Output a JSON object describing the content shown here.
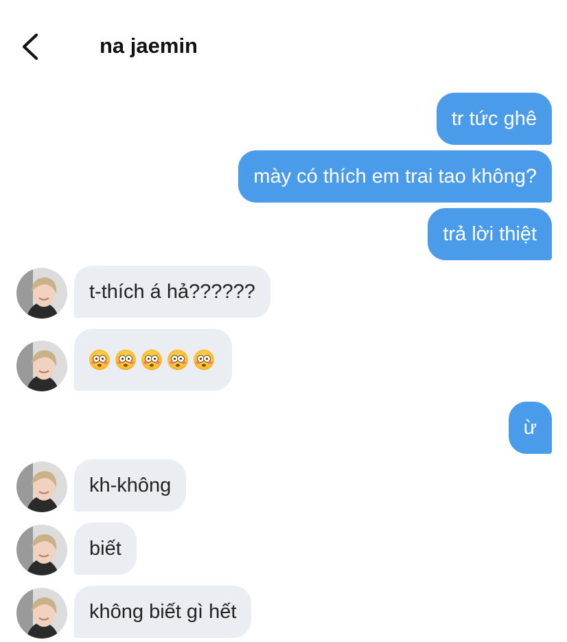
{
  "header": {
    "contact_name": "na jaemin",
    "back_icon": "chevron-left-icon"
  },
  "colors": {
    "outgoing_bubble": "#4a9bea",
    "incoming_bubble": "#eaedf1"
  },
  "messages": [
    {
      "direction": "outgoing",
      "text": "tr tức ghê"
    },
    {
      "direction": "outgoing",
      "text": "mày có thích em trai tao không?"
    },
    {
      "direction": "outgoing",
      "text": "trả lời thiệt"
    },
    {
      "direction": "incoming",
      "text": "t-thích á hả??????"
    },
    {
      "direction": "incoming",
      "text": "",
      "emoji": [
        "flushed-face",
        "flushed-face",
        "flushed-face",
        "flushed-face",
        "flushed-face"
      ]
    },
    {
      "direction": "outgoing",
      "text": "ừ"
    },
    {
      "direction": "incoming",
      "text": "kh-không"
    },
    {
      "direction": "incoming",
      "text": "biết"
    },
    {
      "direction": "incoming",
      "text": "không biết gì hết"
    }
  ]
}
